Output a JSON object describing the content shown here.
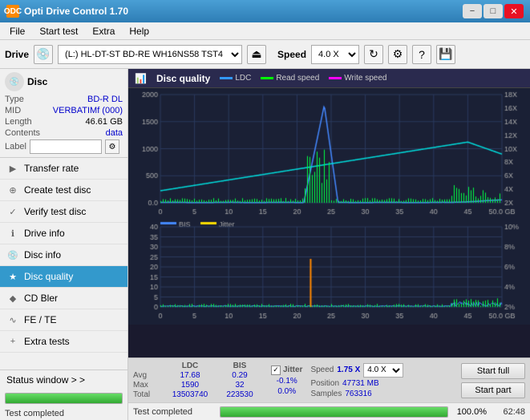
{
  "app": {
    "title": "Opti Drive Control 1.70",
    "icon": "ODC"
  },
  "titlebar": {
    "minimize": "−",
    "maximize": "□",
    "close": "✕"
  },
  "menu": {
    "items": [
      "File",
      "Start test",
      "Extra",
      "Help"
    ]
  },
  "toolbar": {
    "drive_label": "Drive",
    "drive_value": "(L:)  HL-DT-ST BD-RE  WH16NS58 TST4",
    "speed_label": "Speed",
    "speed_value": "4.0 X"
  },
  "disc": {
    "label": "Disc",
    "type_key": "Type",
    "type_val": "BD-R DL",
    "mid_key": "MID",
    "mid_val": "VERBATIMf (000)",
    "length_key": "Length",
    "length_val": "46.61 GB",
    "contents_key": "Contents",
    "contents_val": "data",
    "label_key": "Label",
    "label_placeholder": ""
  },
  "nav": {
    "items": [
      {
        "id": "transfer-rate",
        "label": "Transfer rate",
        "icon": "▶"
      },
      {
        "id": "create-test-disc",
        "label": "Create test disc",
        "icon": "⊕"
      },
      {
        "id": "verify-test-disc",
        "label": "Verify test disc",
        "icon": "✓"
      },
      {
        "id": "drive-info",
        "label": "Drive info",
        "icon": "ℹ"
      },
      {
        "id": "disc-info",
        "label": "Disc info",
        "icon": "💿"
      },
      {
        "id": "disc-quality",
        "label": "Disc quality",
        "icon": "★",
        "active": true
      },
      {
        "id": "cd-bler",
        "label": "CD Bler",
        "icon": "◆"
      },
      {
        "id": "fe-te",
        "label": "FE / TE",
        "icon": "∿"
      },
      {
        "id": "extra-tests",
        "label": "Extra tests",
        "icon": "+"
      }
    ]
  },
  "status_window": {
    "label": "Status window > >"
  },
  "chart": {
    "title": "Disc quality",
    "legends": [
      {
        "id": "ldc",
        "label": "LDC",
        "color": "#3399ff"
      },
      {
        "id": "read",
        "label": "Read speed",
        "color": "#00ff00"
      },
      {
        "id": "write",
        "label": "Write speed",
        "color": "#ff00ff"
      }
    ],
    "top": {
      "y_max": 2000,
      "y_labels": [
        2000,
        1500,
        1000,
        500,
        0
      ],
      "y_right_labels": [
        "18X",
        "16X",
        "14X",
        "12X",
        "10X",
        "8X",
        "6X",
        "4X",
        "2X"
      ],
      "x_labels": [
        0,
        5,
        10,
        15,
        20,
        25,
        30,
        35,
        40,
        45,
        "50.0 GB"
      ]
    },
    "bottom": {
      "title1": "BIS",
      "title2": "Jitter",
      "y_max": 40,
      "y_labels": [
        40,
        35,
        30,
        25,
        20,
        15,
        10,
        5
      ],
      "y_right_labels": [
        "10%",
        "8%",
        "6%",
        "4%",
        "2%"
      ],
      "x_labels": [
        0,
        5,
        10,
        15,
        20,
        25,
        30,
        35,
        40,
        45,
        "50.0 GB"
      ]
    }
  },
  "stats": {
    "headers": [
      "",
      "LDC",
      "BIS",
      "",
      "Jitter",
      "Speed",
      ""
    ],
    "avg_label": "Avg",
    "avg_ldc": "17.68",
    "avg_bis": "0.29",
    "avg_jitter": "-0.1%",
    "max_label": "Max",
    "max_ldc": "1590",
    "max_bis": "32",
    "max_jitter": "0.0%",
    "total_label": "Total",
    "total_ldc": "13503740",
    "total_bis": "223530",
    "speed_label": "Speed",
    "speed_val": "1.75 X",
    "speed_select": "4.0 X",
    "position_label": "Position",
    "position_val": "47731 MB",
    "samples_label": "Samples",
    "samples_val": "763316",
    "jitter_checked": true
  },
  "buttons": {
    "start_full": "Start full",
    "start_part": "Start part"
  },
  "bottom_bar": {
    "status": "Test completed",
    "percent": "100.0%",
    "time": "62:48"
  }
}
